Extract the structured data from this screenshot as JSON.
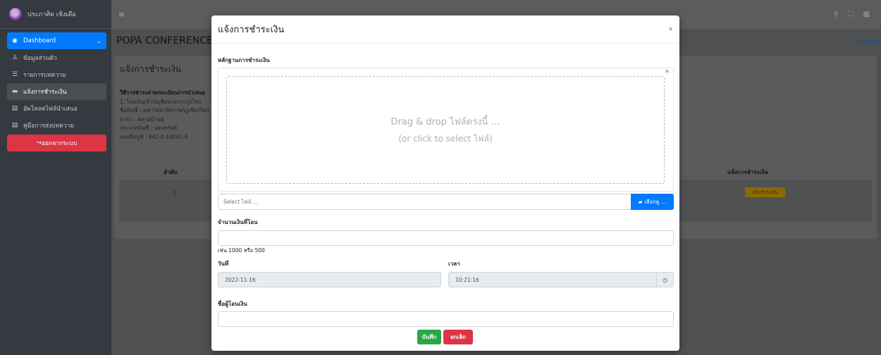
{
  "sidebar": {
    "brand": "ประภาศิต เชิงเดือ",
    "items": [
      {
        "label": "Dashboard",
        "icon": "tachometer-icon"
      },
      {
        "label": "ข้อมูลส่วนตัว",
        "icon": "user-icon"
      },
      {
        "label": "รายการบทความ",
        "icon": "list-icon"
      },
      {
        "label": "แจ้งการชำระเงิน",
        "icon": "money-icon"
      },
      {
        "label": "อัพโหลดไฟล์นำเสนอ",
        "icon": "file-upload-icon"
      },
      {
        "label": "คู่มือการส่งบทความ",
        "icon": "file-icon"
      }
    ],
    "logout": "ออกจากระบบ"
  },
  "topbar": {
    "menu_icon": "≡"
  },
  "content": {
    "page_title": "POPA CONFERENCE",
    "home": "Home",
    "card_title": "แจ้งการชำระเงิน",
    "method_title": "วิธีการชำระค่าลงทะเบียนการนำเสนอ",
    "method_lines": [
      "1. โอนเงินเข้าบัญชีธนาคารกรุงไทย",
      "ชื่อบัญชี : มหาวิทยาลัยราชภัฏเชียงใหม่",
      "สาขา : ตลาดบ้านดู่",
      "ประเภทบัญชี : ออมทรัพย์",
      "เลขที่บัญชี : 842-0-14041-4"
    ],
    "col_no": "ลำดับ",
    "col_pay": "แจ้งการชำระเงิน",
    "row_no": "1",
    "row_pay_button": "แจ้งชำระเงิน"
  },
  "modal": {
    "title": "แจ้งการชำระเงิน",
    "evidence_label": "หลักฐานการชำระเงิน",
    "dropzone_line1": "Drag & drop ไฟล์ตรงนี้ …",
    "dropzone_line2": "(or click to select ไฟล์)",
    "file_placeholder": "Select ไฟล์ ...",
    "browse_label": "เลือกดู …",
    "amount_label": "จำนวนเงินที่โอน",
    "amount_value": "",
    "amount_help": "เช่น 1000 หรือ 500",
    "date_label": "วันที่",
    "date_value": "2022-11-16",
    "time_label": "เวลา",
    "time_value": "10:21:16",
    "payer_label": "ชื่อผู้โอนเงิน",
    "payer_value": "",
    "save_label": "บันทึก",
    "cancel_label": "ยกเลิก"
  }
}
